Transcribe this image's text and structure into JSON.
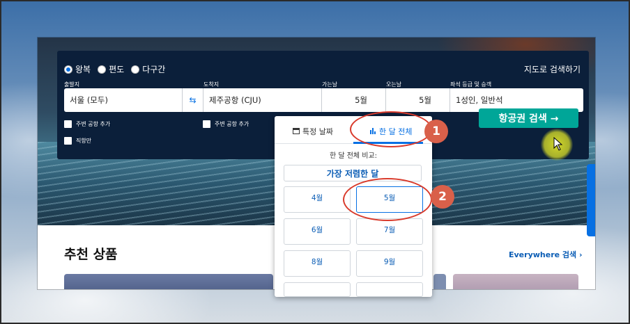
{
  "trip_types": [
    {
      "label": "왕복",
      "selected": true
    },
    {
      "label": "편도",
      "selected": false
    },
    {
      "label": "다구간",
      "selected": false
    }
  ],
  "map_search": "지도로 검색하기",
  "labels": {
    "origin": "출발지",
    "destination": "도착지",
    "depart": "가는날",
    "return": "오는날",
    "cabin": "좌석 등급 및 승객"
  },
  "fields": {
    "origin": "서울 (모두)",
    "destination": "제주공항 (CJU)",
    "depart": "5월",
    "return": "5월",
    "cabin": "1성인, 일반석"
  },
  "checkboxes": {
    "nearby_origin": "주변 공항 추가",
    "nearby_dest": "주변 공항 추가",
    "direct": "직항만"
  },
  "search_button": "항공권 검색 →",
  "dropdown": {
    "tab_specific": "특정 날짜",
    "tab_whole": "한 달 전체",
    "compare_label": "한 달 전체 비교:",
    "cheapest": "가장 저렴한 달",
    "months": [
      "4월",
      "5월",
      "6월",
      "7월",
      "8월",
      "9월"
    ],
    "selected_month": "5월"
  },
  "section_title": "추천 상품",
  "everywhere_link": "Everywhere 검색 ›",
  "annotations": [
    "1",
    "2"
  ],
  "colors": {
    "panel": "#0b1f3a",
    "accent_blue": "#0770e3",
    "search_green": "#00a698",
    "annotation_red": "#d93a2b"
  }
}
